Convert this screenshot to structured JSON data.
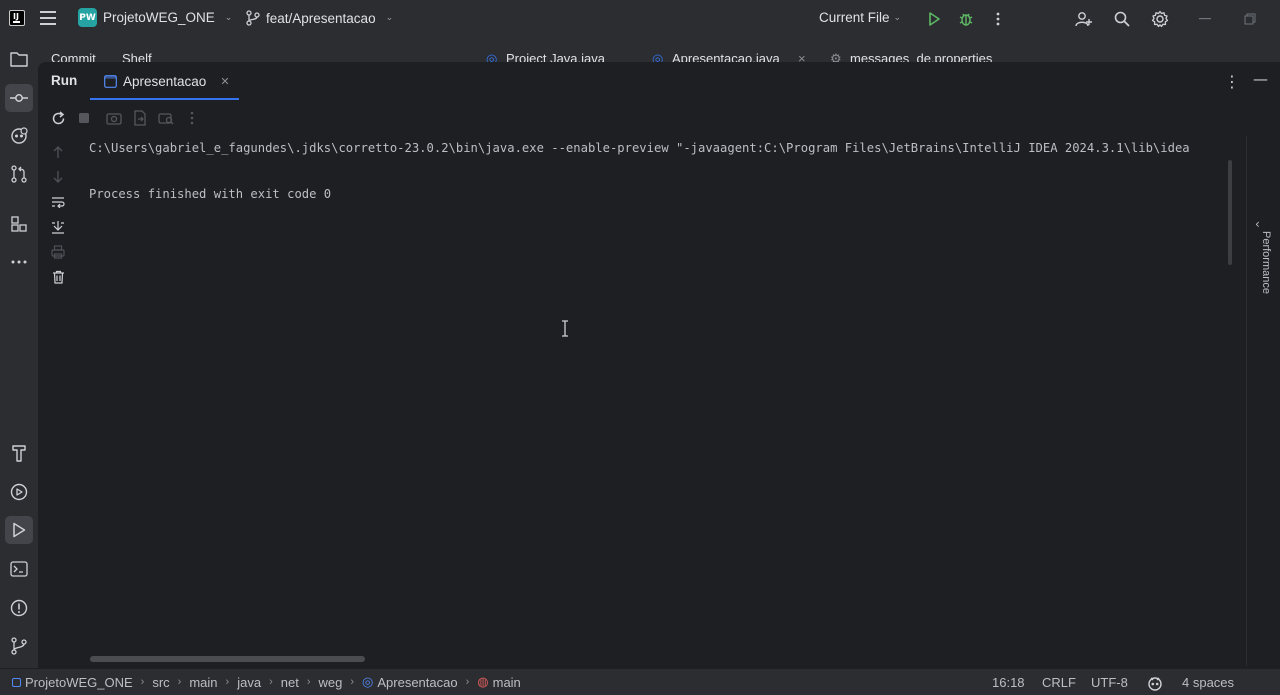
{
  "titlebar": {
    "project_initials": "PW",
    "project_name": "ProjetoWEG_ONE",
    "branch": "feat/Apresentacao",
    "run_config": "Current File"
  },
  "background_tabs": {
    "left": [
      "Commit",
      "Shelf"
    ],
    "files": [
      "Project Java.java",
      "Apresentacao.java",
      "messages_de.properties"
    ]
  },
  "run_window": {
    "title": "Run",
    "tab_label": "Apresentacao",
    "console_lines": [
      "C:\\Users\\gabriel_e_fagundes\\.jdks\\corretto-23.0.2\\bin\\java.exe --enable-preview \"-javaagent:C:\\Program Files\\JetBrains\\IntelliJ IDEA 2024.3.1\\lib\\idea",
      "Process finished with exit code 0"
    ],
    "side_panel_label": "Performance"
  },
  "statusbar": {
    "breadcrumbs": [
      "ProjetoWEG_ONE",
      "src",
      "main",
      "java",
      "net",
      "weg",
      "Apresentacao",
      "main"
    ],
    "position": "16:18",
    "line_separator": "CRLF",
    "encoding": "UTF-8",
    "indent": "4 spaces"
  },
  "colors": {
    "accent": "#3574f0",
    "project_badge": "#26a3a3",
    "run_green": "#5fb865"
  }
}
